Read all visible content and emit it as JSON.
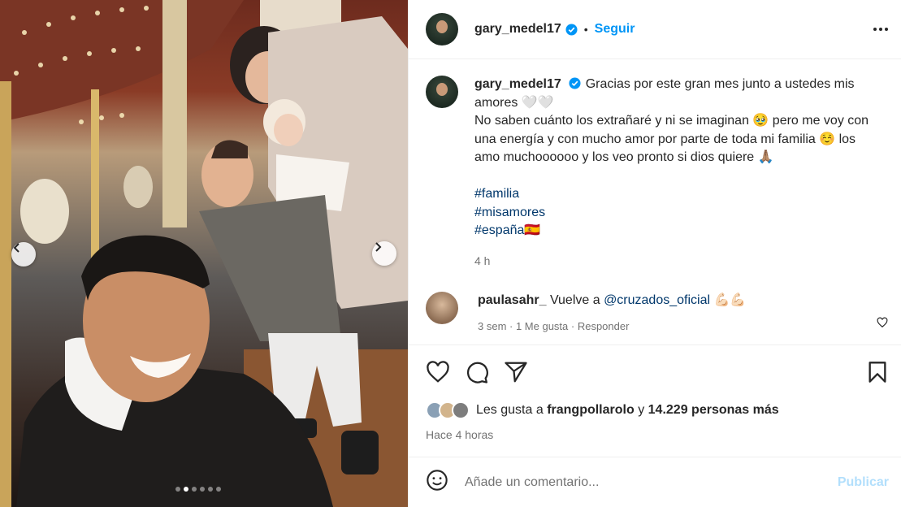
{
  "post": {
    "username": "gary_medel17",
    "separator": "•",
    "follow_label": "Seguir",
    "caption_line1": "Gracias por este gran mes junto a ustedes mis amores 🤍🤍",
    "caption_line2": "No saben cuánto los extrañaré y ni se imaginan 🥹 pero me voy con una energía y con mucho amor por parte de toda mi familia ☺️ los amo muchoooooo y los veo pronto si dios quiere 🙏🏽",
    "hashtags": [
      "#familia",
      "#misamores",
      "#españa🇪🇸"
    ],
    "caption_time": "4 h",
    "colors": {
      "accent": "#0095f6",
      "link": "#00376b",
      "muted": "#737373"
    }
  },
  "comment": {
    "username": "paulasahr_",
    "prefix": "Vuelve a",
    "mention": "@cruzados_oficial",
    "suffix": "💪🏻💪🏻",
    "meta": "3 sem · 1 Me gusta · Responder"
  },
  "likes": {
    "prefix": "Les gusta a",
    "user": "frangpollarolo",
    "middle": "y",
    "others": "14.229 personas más"
  },
  "posted": "Hace 4 horas",
  "add_comment": {
    "placeholder": "Añade un comentario...",
    "publish_label": "Publicar"
  },
  "carousel": {
    "total": 6,
    "active_index": 1
  },
  "icons": [
    "heart-icon",
    "comment-icon",
    "share-icon",
    "bookmark-icon",
    "emoji-icon",
    "more-icon",
    "verified-icon",
    "chevron-left-icon",
    "chevron-right-icon"
  ]
}
